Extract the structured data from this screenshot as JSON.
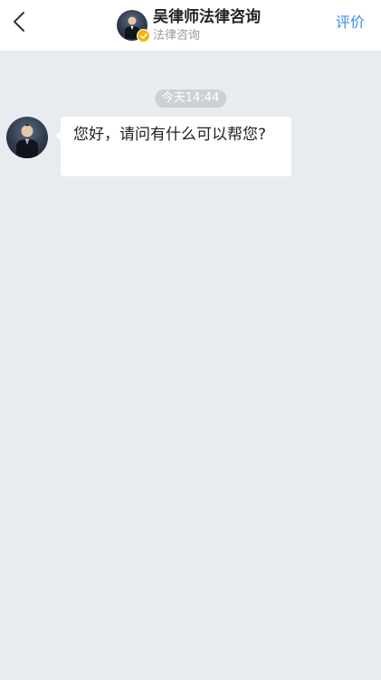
{
  "header": {
    "title": "吴律师法律咨询",
    "subtitle": "法律咨询",
    "rate_label": "评价",
    "back_icon": "chevron-left-icon",
    "verified_icon": "check-badge-icon"
  },
  "chat": {
    "timestamp": "今天14:44",
    "messages": [
      {
        "sender": "lawyer",
        "text": "您好，请问有什么可以帮您?"
      }
    ]
  },
  "colors": {
    "background": "#e8ebf0",
    "accent": "#3a8ee6",
    "verified": "#f5b400",
    "bubble": "#ffffff"
  }
}
